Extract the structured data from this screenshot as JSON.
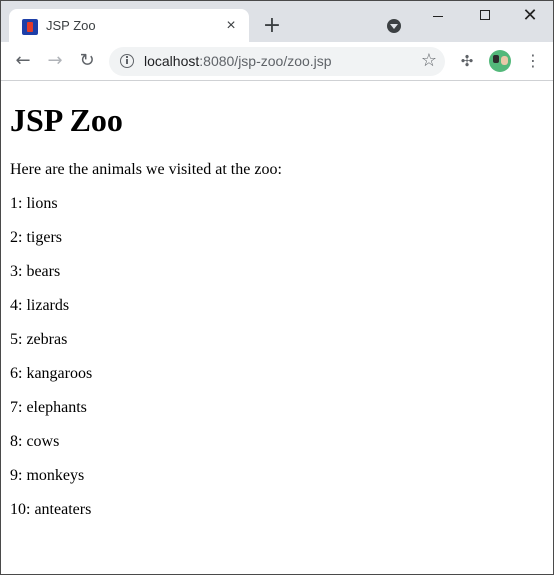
{
  "browser": {
    "tab_title": "JSP Zoo",
    "tab_close": "×",
    "new_tab": "+",
    "url_host": "localhost",
    "url_path": ":8080/jsp-zoo/zoo.jsp"
  },
  "page": {
    "heading": "JSP Zoo",
    "intro": "Here are the animals we visited at the zoo:",
    "animals": [
      "1: lions",
      "2: tigers",
      "3: bears",
      "4: lizards",
      "5: zebras",
      "6: kangaroos",
      "7: elephants",
      "8: cows",
      "9: monkeys",
      "10: anteaters"
    ]
  }
}
